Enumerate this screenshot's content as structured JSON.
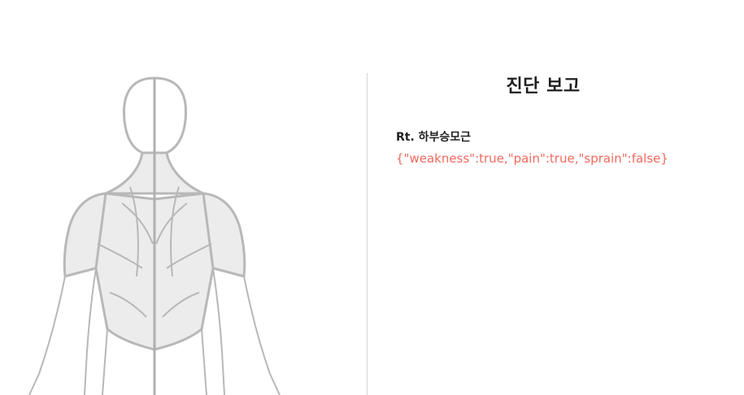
{
  "report": {
    "title": "진단 보고",
    "findings": [
      {
        "muscle": "Rt. 하부승모근",
        "detail": "{\"weakness\":true,\"pain\":true,\"sprain\":false}"
      }
    ]
  },
  "figure": {
    "view": "back",
    "outline_color": "#b8b8b8",
    "muscle_fill": "#ececec"
  },
  "colors": {
    "accent": "#f06a5e",
    "divider": "#d4d4d4"
  }
}
